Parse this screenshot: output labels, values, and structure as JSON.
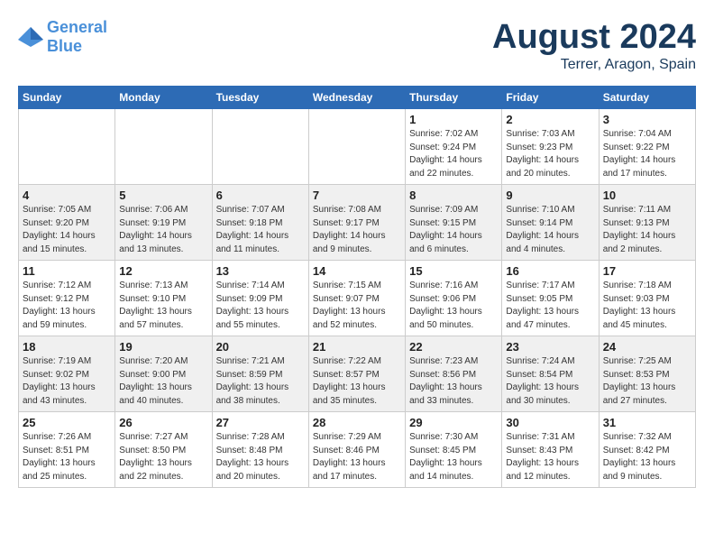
{
  "logo": {
    "line1": "General",
    "line2": "Blue"
  },
  "header": {
    "month_year": "August 2024",
    "location": "Terrer, Aragon, Spain"
  },
  "days_of_week": [
    "Sunday",
    "Monday",
    "Tuesday",
    "Wednesday",
    "Thursday",
    "Friday",
    "Saturday"
  ],
  "rows": [
    {
      "alt": false,
      "cells": [
        {
          "day": "",
          "info": ""
        },
        {
          "day": "",
          "info": ""
        },
        {
          "day": "",
          "info": ""
        },
        {
          "day": "",
          "info": ""
        },
        {
          "day": "1",
          "info": "Sunrise: 7:02 AM\nSunset: 9:24 PM\nDaylight: 14 hours\nand 22 minutes."
        },
        {
          "day": "2",
          "info": "Sunrise: 7:03 AM\nSunset: 9:23 PM\nDaylight: 14 hours\nand 20 minutes."
        },
        {
          "day": "3",
          "info": "Sunrise: 7:04 AM\nSunset: 9:22 PM\nDaylight: 14 hours\nand 17 minutes."
        }
      ]
    },
    {
      "alt": true,
      "cells": [
        {
          "day": "4",
          "info": "Sunrise: 7:05 AM\nSunset: 9:20 PM\nDaylight: 14 hours\nand 15 minutes."
        },
        {
          "day": "5",
          "info": "Sunrise: 7:06 AM\nSunset: 9:19 PM\nDaylight: 14 hours\nand 13 minutes."
        },
        {
          "day": "6",
          "info": "Sunrise: 7:07 AM\nSunset: 9:18 PM\nDaylight: 14 hours\nand 11 minutes."
        },
        {
          "day": "7",
          "info": "Sunrise: 7:08 AM\nSunset: 9:17 PM\nDaylight: 14 hours\nand 9 minutes."
        },
        {
          "day": "8",
          "info": "Sunrise: 7:09 AM\nSunset: 9:15 PM\nDaylight: 14 hours\nand 6 minutes."
        },
        {
          "day": "9",
          "info": "Sunrise: 7:10 AM\nSunset: 9:14 PM\nDaylight: 14 hours\nand 4 minutes."
        },
        {
          "day": "10",
          "info": "Sunrise: 7:11 AM\nSunset: 9:13 PM\nDaylight: 14 hours\nand 2 minutes."
        }
      ]
    },
    {
      "alt": false,
      "cells": [
        {
          "day": "11",
          "info": "Sunrise: 7:12 AM\nSunset: 9:12 PM\nDaylight: 13 hours\nand 59 minutes."
        },
        {
          "day": "12",
          "info": "Sunrise: 7:13 AM\nSunset: 9:10 PM\nDaylight: 13 hours\nand 57 minutes."
        },
        {
          "day": "13",
          "info": "Sunrise: 7:14 AM\nSunset: 9:09 PM\nDaylight: 13 hours\nand 55 minutes."
        },
        {
          "day": "14",
          "info": "Sunrise: 7:15 AM\nSunset: 9:07 PM\nDaylight: 13 hours\nand 52 minutes."
        },
        {
          "day": "15",
          "info": "Sunrise: 7:16 AM\nSunset: 9:06 PM\nDaylight: 13 hours\nand 50 minutes."
        },
        {
          "day": "16",
          "info": "Sunrise: 7:17 AM\nSunset: 9:05 PM\nDaylight: 13 hours\nand 47 minutes."
        },
        {
          "day": "17",
          "info": "Sunrise: 7:18 AM\nSunset: 9:03 PM\nDaylight: 13 hours\nand 45 minutes."
        }
      ]
    },
    {
      "alt": true,
      "cells": [
        {
          "day": "18",
          "info": "Sunrise: 7:19 AM\nSunset: 9:02 PM\nDaylight: 13 hours\nand 43 minutes."
        },
        {
          "day": "19",
          "info": "Sunrise: 7:20 AM\nSunset: 9:00 PM\nDaylight: 13 hours\nand 40 minutes."
        },
        {
          "day": "20",
          "info": "Sunrise: 7:21 AM\nSunset: 8:59 PM\nDaylight: 13 hours\nand 38 minutes."
        },
        {
          "day": "21",
          "info": "Sunrise: 7:22 AM\nSunset: 8:57 PM\nDaylight: 13 hours\nand 35 minutes."
        },
        {
          "day": "22",
          "info": "Sunrise: 7:23 AM\nSunset: 8:56 PM\nDaylight: 13 hours\nand 33 minutes."
        },
        {
          "day": "23",
          "info": "Sunrise: 7:24 AM\nSunset: 8:54 PM\nDaylight: 13 hours\nand 30 minutes."
        },
        {
          "day": "24",
          "info": "Sunrise: 7:25 AM\nSunset: 8:53 PM\nDaylight: 13 hours\nand 27 minutes."
        }
      ]
    },
    {
      "alt": false,
      "cells": [
        {
          "day": "25",
          "info": "Sunrise: 7:26 AM\nSunset: 8:51 PM\nDaylight: 13 hours\nand 25 minutes."
        },
        {
          "day": "26",
          "info": "Sunrise: 7:27 AM\nSunset: 8:50 PM\nDaylight: 13 hours\nand 22 minutes."
        },
        {
          "day": "27",
          "info": "Sunrise: 7:28 AM\nSunset: 8:48 PM\nDaylight: 13 hours\nand 20 minutes."
        },
        {
          "day": "28",
          "info": "Sunrise: 7:29 AM\nSunset: 8:46 PM\nDaylight: 13 hours\nand 17 minutes."
        },
        {
          "day": "29",
          "info": "Sunrise: 7:30 AM\nSunset: 8:45 PM\nDaylight: 13 hours\nand 14 minutes."
        },
        {
          "day": "30",
          "info": "Sunrise: 7:31 AM\nSunset: 8:43 PM\nDaylight: 13 hours\nand 12 minutes."
        },
        {
          "day": "31",
          "info": "Sunrise: 7:32 AM\nSunset: 8:42 PM\nDaylight: 13 hours\nand 9 minutes."
        }
      ]
    }
  ]
}
